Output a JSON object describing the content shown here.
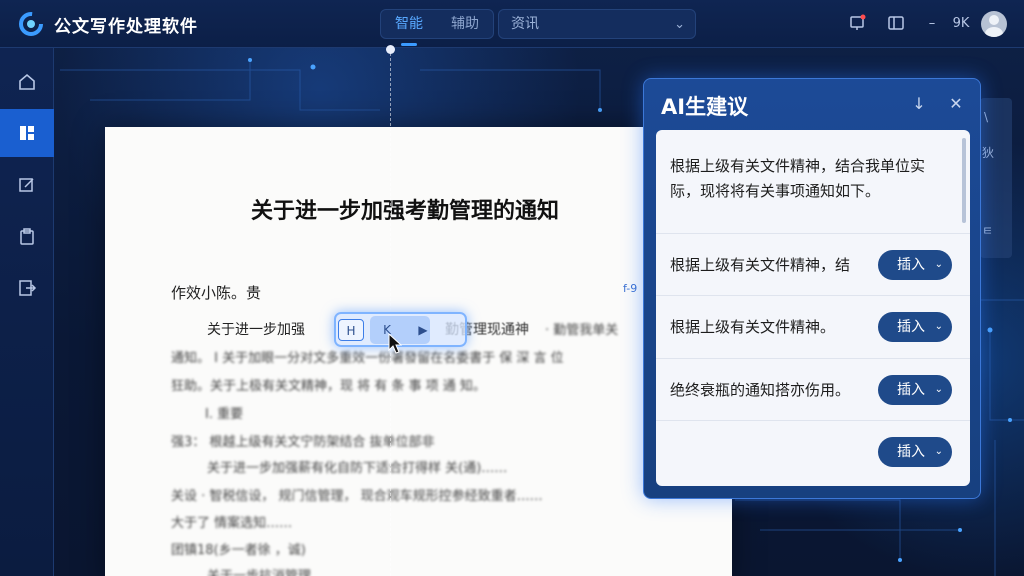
{
  "app": {
    "title": "公文写作处理软件"
  },
  "header": {
    "tabs": [
      {
        "label": "智能",
        "active": true
      },
      {
        "label": "辅助",
        "active": false
      }
    ],
    "select": {
      "value": "资讯"
    },
    "user_label": "9K"
  },
  "document": {
    "title": "关于进一步加强考勤管理的通知",
    "salutation": "作效小陈。贵",
    "margin_mark": "f-9",
    "line1_start": "关于进一步加强",
    "line1_end": "勤管理现通神",
    "blurred_lines": [
      "· 勤管我单关",
      "通知。 I 关于加眼一分对文多重效一份署發留在名委書于 保 深 言 位",
      "狂助。关于上极有关文精神，现 将 有 条 事 项 通 知。",
      "I. 重要",
      "强3： 根越上级有关文宁防架结合 抜单位部非",
      "关于进一步加强薪有化自防下适合打得样 关(通)……",
      "关设 · 智税信设， 规门信管理， 现合观车规形控参经致重者……",
      "大于了 情案选知……",
      "团镇18(乡一者徐 ，诚)",
      "关于一步抗消管理"
    ],
    "toolbar": {
      "btn1": "H",
      "btn2": "K",
      "btn3": "▶"
    }
  },
  "ai_panel": {
    "title": "AI生建议",
    "main_suggestion": "根据上级有关文件精神，结合我单位实际，现将将有关事项通知如下。",
    "suggestions": [
      {
        "text": "根据上级有关文件精神，结",
        "button": "插入"
      },
      {
        "text": "根据上级有关文件精神。",
        "button": "插入"
      },
      {
        "text": "绝终衰瓶的通知搭亦伤用。",
        "button": "插入"
      },
      {
        "text": "",
        "button": "插入"
      }
    ]
  },
  "ghost_strip": {
    "items": [
      "\\",
      "狄",
      "ㅌ"
    ]
  },
  "colors": {
    "accent": "#1a5fd0",
    "button": "#1f4a8a",
    "panel": "#1c4a97",
    "background": "#0b1a3a"
  }
}
